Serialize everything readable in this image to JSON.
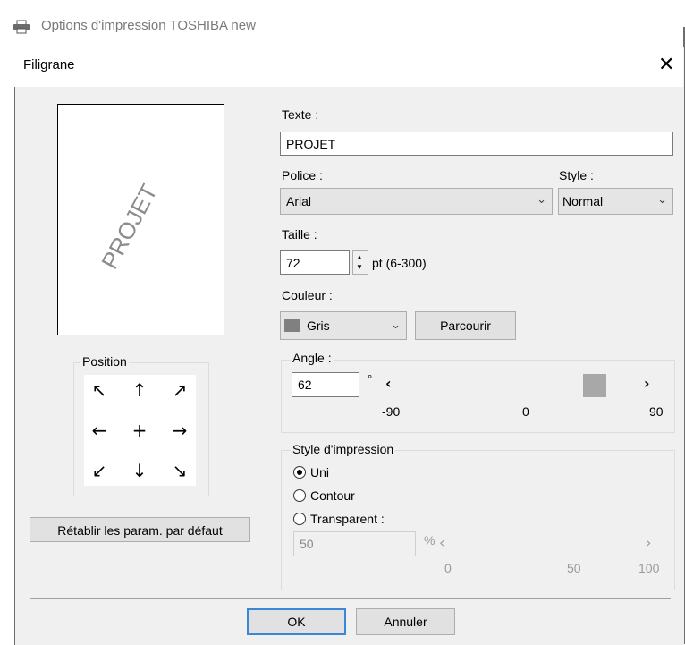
{
  "background_window": {
    "title": "Options d'impression TOSHIBA new",
    "icon": "printer-icon"
  },
  "dialog": {
    "title": "Filigrane",
    "close_icon": "close-icon"
  },
  "preview": {
    "text": "PROJET",
    "rotation_deg": 62
  },
  "position": {
    "label": "Position",
    "arrows": [
      "↖",
      "↑",
      "↗",
      "←",
      "+",
      "→",
      "↙",
      "↓",
      "↘"
    ]
  },
  "reset_button": "Rétablir les param. par défaut",
  "texte": {
    "label": "Texte :",
    "value": "PROJET"
  },
  "police": {
    "label": "Police :",
    "value": "Arial"
  },
  "style": {
    "label": "Style :",
    "value": "Normal"
  },
  "taille": {
    "label": "Taille :",
    "value": "72",
    "unit": "pt (6-300)"
  },
  "couleur": {
    "label": "Couleur :",
    "value": "Gris",
    "swatch": "#808080",
    "browse": "Parcourir"
  },
  "angle": {
    "label": "Angle :",
    "value": "62",
    "degree": "°",
    "min": "-90",
    "mid": "0",
    "max": "90",
    "slider_value": 62
  },
  "print_style": {
    "label": "Style d'impression",
    "options": [
      {
        "label": "Uni",
        "selected": true
      },
      {
        "label": "Contour",
        "selected": false
      },
      {
        "label": "Transparent :",
        "selected": false
      }
    ],
    "transparency": {
      "value": "50",
      "unit": "%",
      "min": "0",
      "mid": "50",
      "max": "100"
    }
  },
  "buttons": {
    "ok": "OK",
    "cancel": "Annuler"
  }
}
